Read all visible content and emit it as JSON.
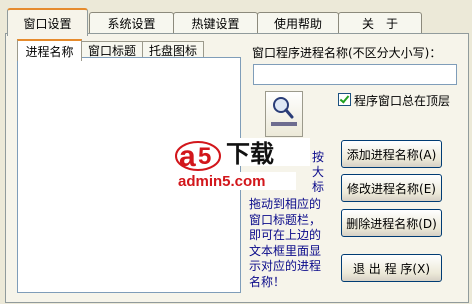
{
  "tabs": [
    "窗口设置",
    "系统设置",
    "热键设置",
    "使用帮助",
    "关　于"
  ],
  "inner_tabs": [
    "进程名称",
    "窗口标题",
    "托盘图标"
  ],
  "process_label": "窗口程序进程名称(不区分大小写)：",
  "process_value": "",
  "always_on_top_label": "程序窗口总在顶层",
  "always_on_top_checked": true,
  "hint_lines": [
    "拖动到相应的",
    "窗口标题栏，",
    "即可在上边的",
    "文本框里面显",
    "示对应的进程",
    "名称！"
  ],
  "hint_visible_fragments": [
    "按",
    "大",
    "标"
  ],
  "buttons": {
    "add": "添加进程名称(A)",
    "modify": "修改进程名称(E)",
    "delete": "删除进程名称(D)",
    "exit": "退 出 程 序(X)"
  },
  "watermark": {
    "brand": "a5下载",
    "site": "admin5.com"
  },
  "icons": [
    "magnifier-icon"
  ]
}
